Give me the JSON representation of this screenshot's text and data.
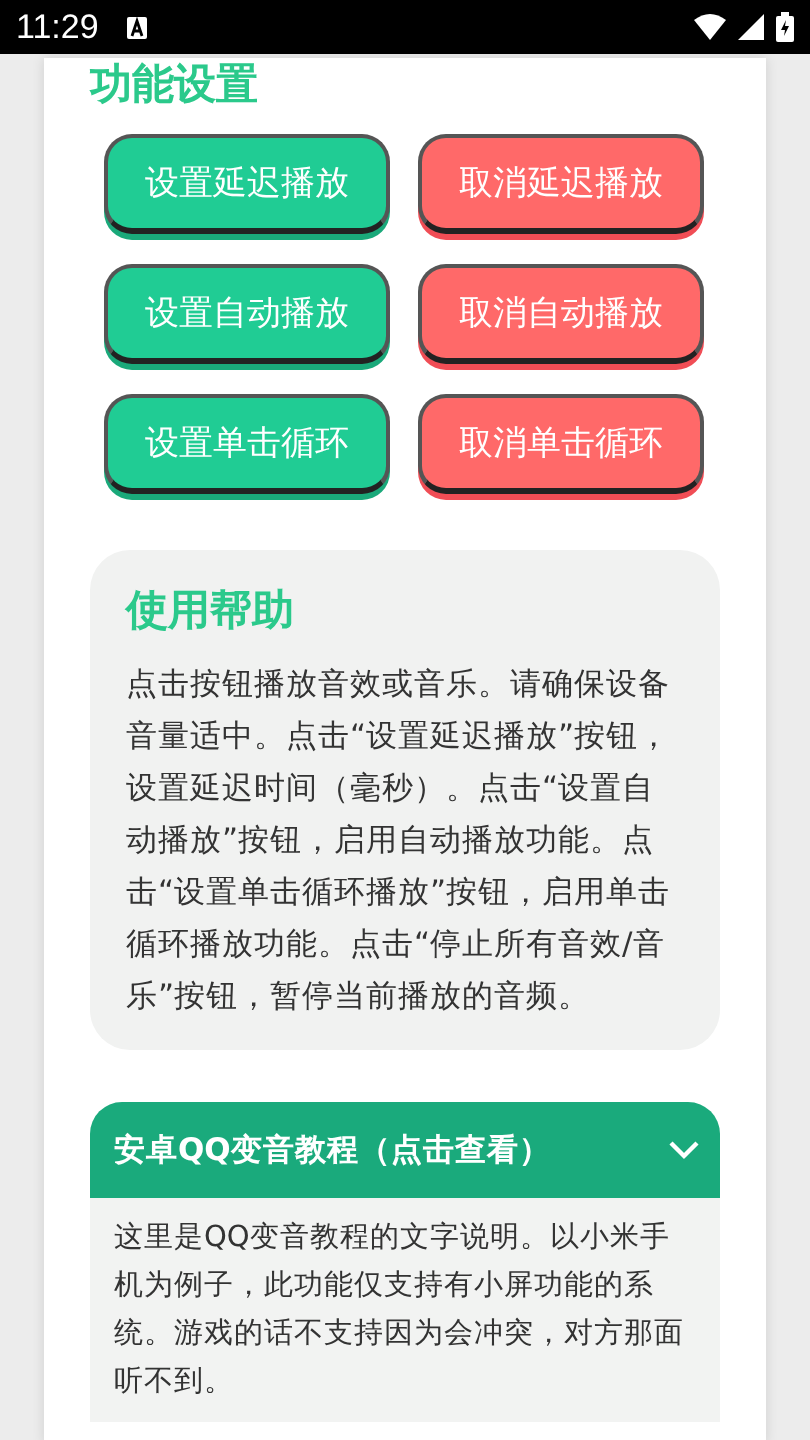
{
  "status_bar": {
    "time": "11:29"
  },
  "section_title": "功能设置",
  "buttons": [
    {
      "label": "设置延迟播放",
      "kind": "set"
    },
    {
      "label": "取消延迟播放",
      "kind": "cancel"
    },
    {
      "label": "设置自动播放",
      "kind": "set"
    },
    {
      "label": "取消自动播放",
      "kind": "cancel"
    },
    {
      "label": "设置单击循环",
      "kind": "set"
    },
    {
      "label": "取消单击循环",
      "kind": "cancel"
    }
  ],
  "help": {
    "title": "使用帮助",
    "text": "点击按钮播放音效或音乐。请确保设备音量适中。点击“设置延迟播放”按钮，设置延迟时间（毫秒）。点击“设置自动播放”按钮，启用自动播放功能。点击“设置单击循环播放”按钮，启用单击循环播放功能。点击“停止所有音效/音乐”按钮，暂停当前播放的音频。"
  },
  "tutorial": {
    "title": "安卓QQ变音教程（点击查看）",
    "expanded": true,
    "text": "这里是QQ变音教程的文字说明。以小米手机为例子，此功能仅支持有小屏功能的系统。游戏的话不支持因为会冲突，对方那面听不到。"
  }
}
